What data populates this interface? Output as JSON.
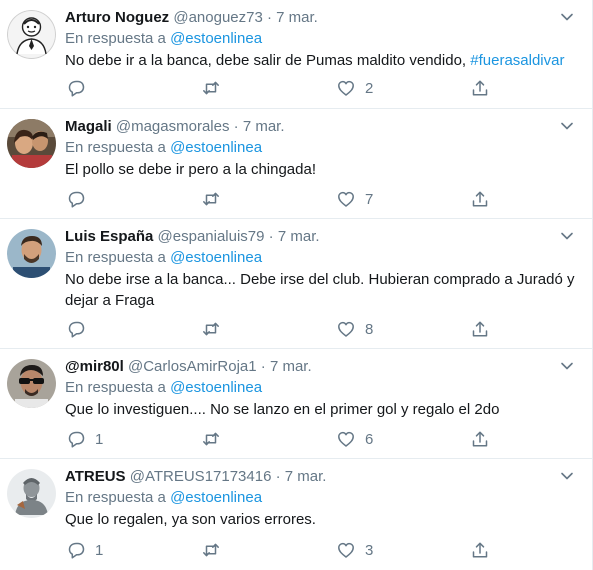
{
  "reply_prefix": "En respuesta a",
  "colors": {
    "link": "#1b95e0",
    "muted": "#657786",
    "text": "#14171a",
    "border": "#e6ecf0"
  },
  "tweets": [
    {
      "name": "Arturo Noguez",
      "handle": "@anoguez73",
      "date": "7 mar.",
      "reply_to": "@estoenlinea",
      "text": "No debe ir a la banca, debe salir de Pumas maldito vendido, ",
      "hashtag": "#fuerasaldivar",
      "replies": "",
      "likes": "2",
      "avatar": "cartoon-man-sketch"
    },
    {
      "name": "Magali",
      "handle": "@magasmorales",
      "date": "7 mar.",
      "reply_to": "@estoenlinea",
      "text": "El pollo se debe ir pero a la chingada!",
      "replies": "",
      "likes": "7",
      "avatar": "couple-photo"
    },
    {
      "name": "Luis España",
      "handle": "@espanialuis79",
      "date": "7 mar.",
      "reply_to": "@estoenlinea",
      "text_line1": "No debe irse a la banca... Debe irse del club. Hubieran comprado a Juradó y",
      "text_line2": "dejar a Fraga",
      "replies": "",
      "likes": "8",
      "avatar": "man-photo"
    },
    {
      "name": "@mir80l",
      "handle": "@CarlosAmirRoja1",
      "date": "7 mar.",
      "reply_to": "@estoenlinea",
      "text": "Que lo investiguen.... No se lanzo en el primer gol y regalo el 2do",
      "replies": "1",
      "likes": "6",
      "avatar": "man-sunglasses-photo"
    },
    {
      "name": "ATREUS",
      "handle": "@ATREUS17173416",
      "date": "7 mar.",
      "reply_to": "@estoenlinea",
      "text": "Que lo regalen, ya son varios errores.",
      "replies": "1",
      "likes": "3",
      "avatar": "warrior-statue"
    }
  ]
}
